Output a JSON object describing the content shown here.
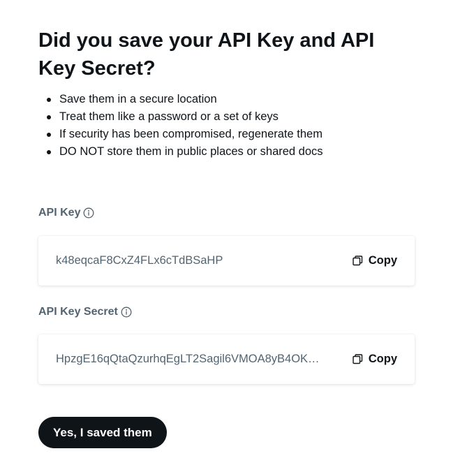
{
  "dialog": {
    "title": "Did you save your API Key and API Key Secret?",
    "tips": [
      "Save them in a secure location",
      "Treat them like a password or a set of keys",
      "If security has been compromised, regenerate them",
      "DO NOT store them in public places or shared docs"
    ]
  },
  "api_key": {
    "label": "API Key",
    "value": "k48eqcaF8CxZ4FLx6cTdBSaHP",
    "copy_label": "Copy",
    "info_icon": "info-icon",
    "copy_icon": "copy-icon"
  },
  "api_key_secret": {
    "label": "API Key Secret",
    "value": "HpzgE16qQtaQzurhqEgLT2Sagil6VMOA8yB4OK…",
    "copy_label": "Copy",
    "info_icon": "info-icon",
    "copy_icon": "copy-icon"
  },
  "confirm_button": {
    "label": "Yes, I saved them"
  },
  "colors": {
    "text_primary": "#0f1419",
    "text_secondary": "#536471",
    "button_bg": "#0f1419",
    "button_text": "#ffffff"
  }
}
